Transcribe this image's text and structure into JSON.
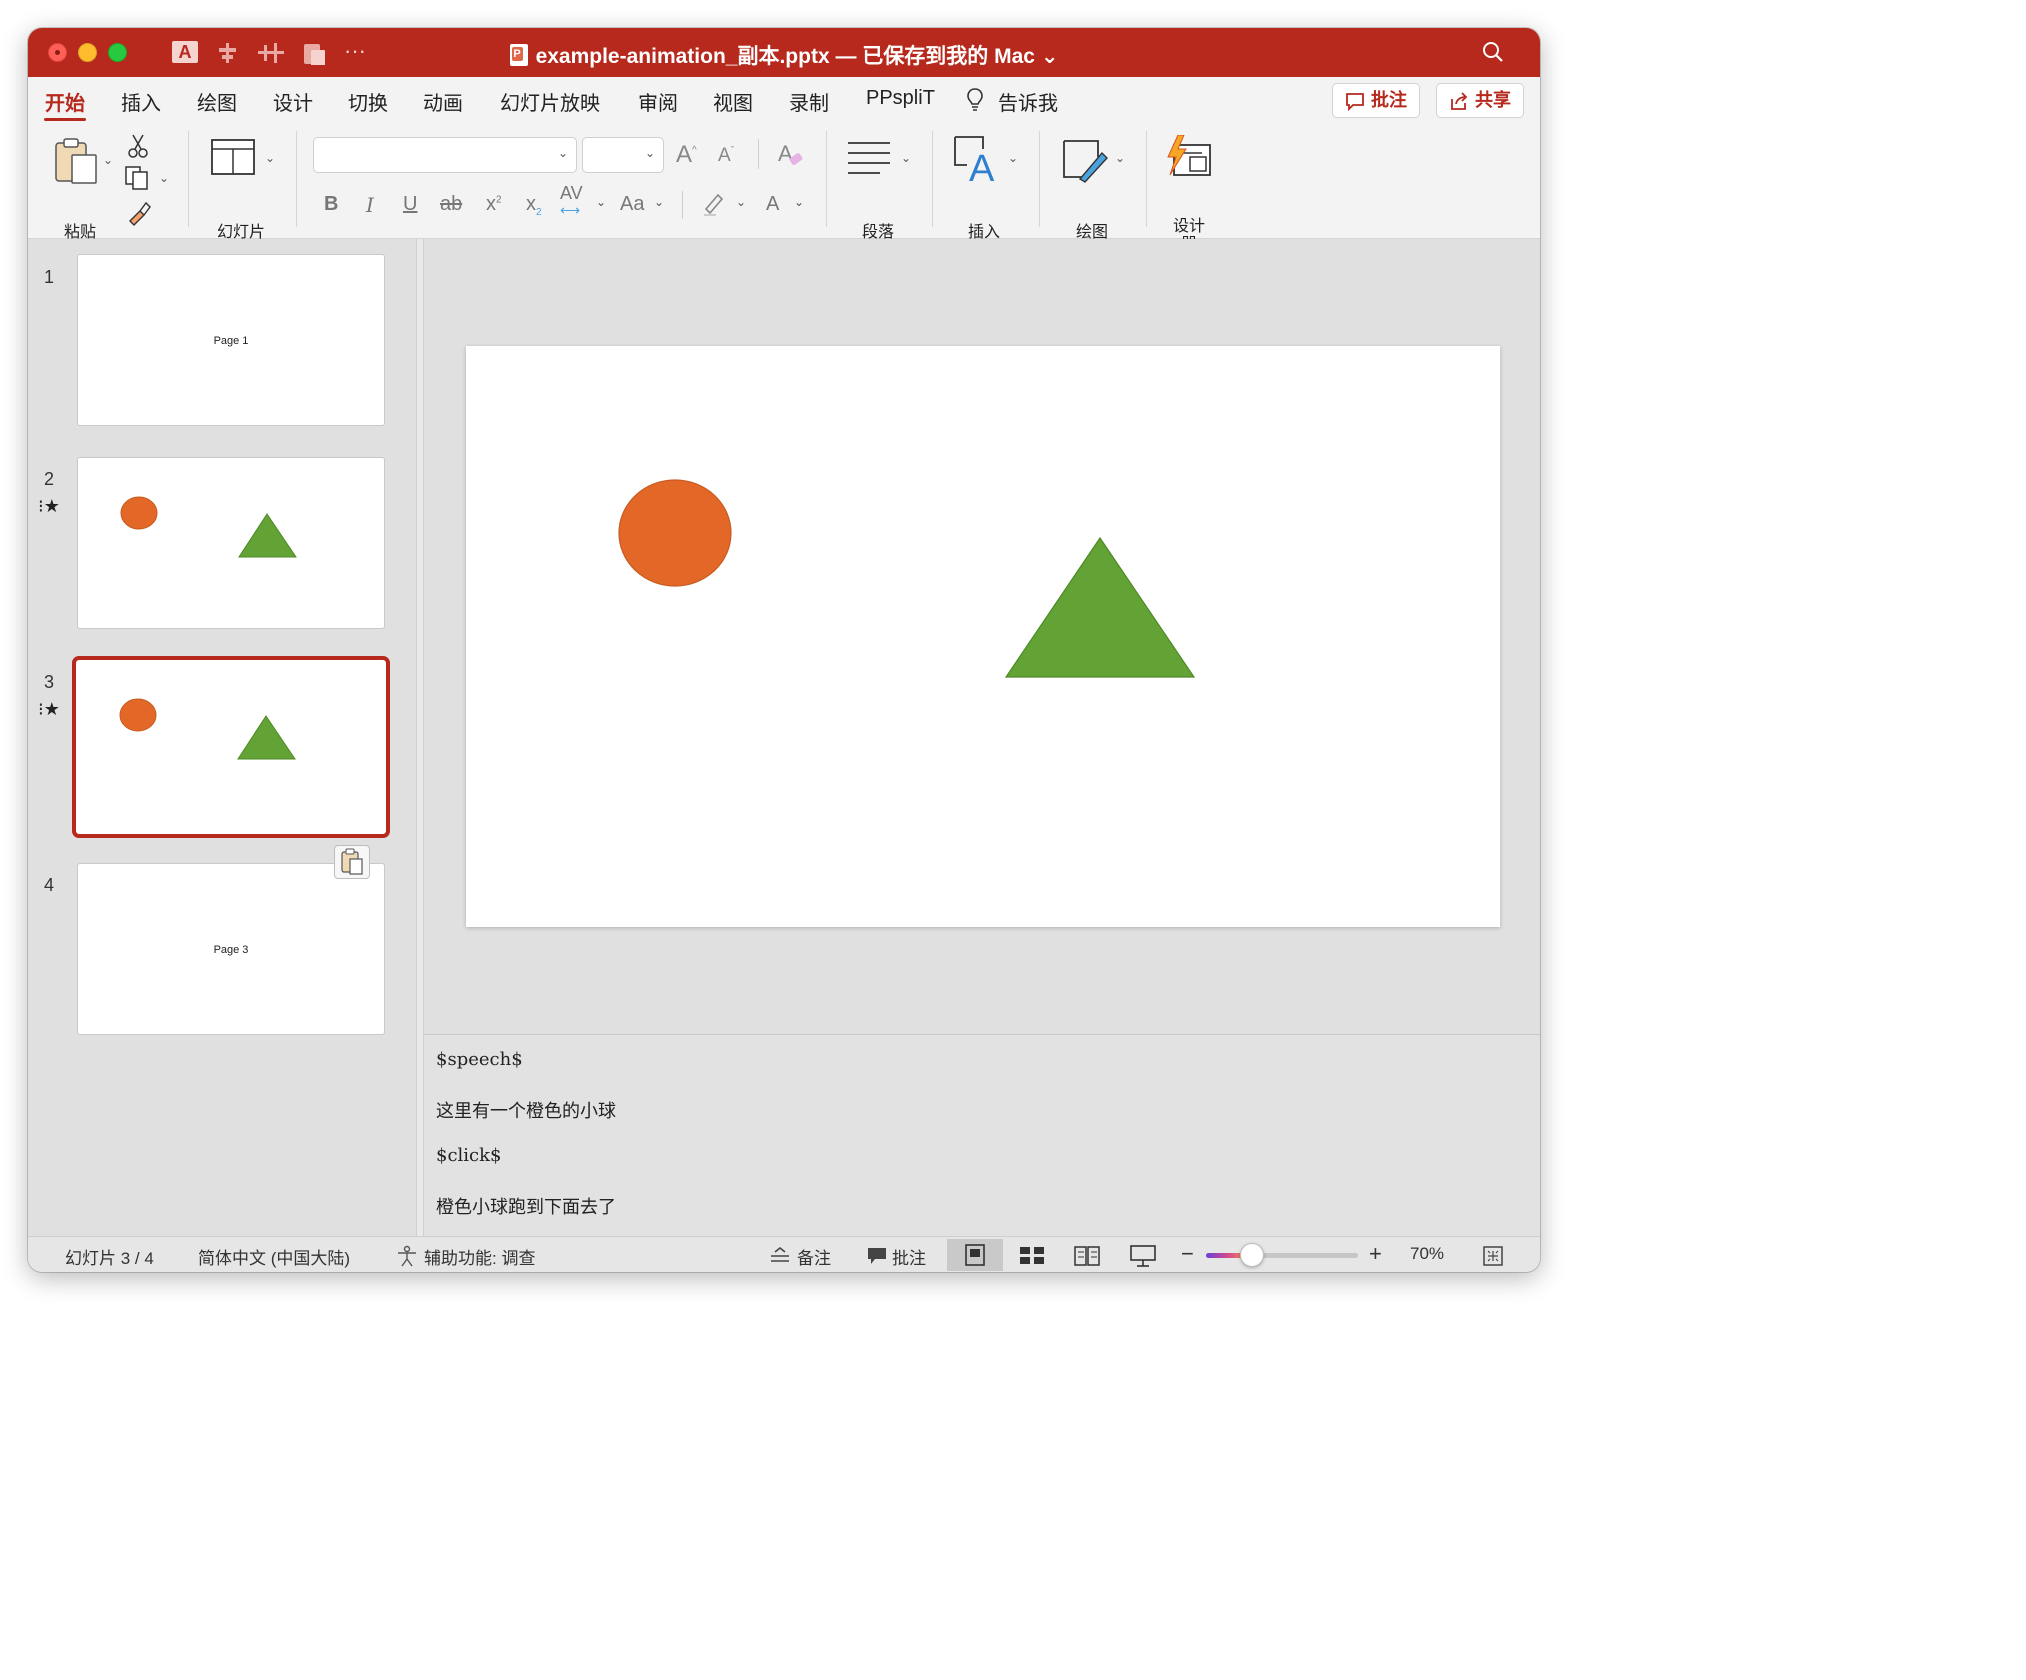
{
  "titlebar": {
    "title": "example-animation_副本.pptx — 已保存到我的 Mac ⌄",
    "qa_font_glyph": "A",
    "qa_more": "···"
  },
  "tabs": [
    {
      "label": "开始",
      "active": true
    },
    {
      "label": "插入"
    },
    {
      "label": "绘图"
    },
    {
      "label": "设计"
    },
    {
      "label": "切换"
    },
    {
      "label": "动画"
    },
    {
      "label": "幻灯片放映"
    },
    {
      "label": "审阅"
    },
    {
      "label": "视图"
    },
    {
      "label": "录制"
    },
    {
      "label": "PPspliT"
    },
    {
      "label": "告诉我"
    }
  ],
  "top_buttons": {
    "comments": "批注",
    "share": "共享"
  },
  "ribbon": {
    "paste": "粘贴",
    "slides": "幻灯片",
    "font_name": "",
    "font_size": "",
    "grow_font": "A",
    "shrink_font": "A",
    "bold": "B",
    "italic": "I",
    "underline": "U",
    "strike": "ab",
    "superscript": "x",
    "subscript": "x",
    "spacing": "AV",
    "change_case": "Aa",
    "font_color": "A",
    "paragraph": "段落",
    "insert": "插入",
    "draw": "绘图",
    "designer": "设计\n器"
  },
  "slides": [
    {
      "number": "1",
      "text": "Page 1",
      "animated": false
    },
    {
      "number": "2",
      "text": "",
      "animated": true
    },
    {
      "number": "3",
      "text": "",
      "animated": true,
      "selected": true
    },
    {
      "number": "4",
      "text": "Page 3",
      "animated": false
    }
  ],
  "animation_marker": "⁝★",
  "colors": {
    "accent": "#b6291c",
    "orange_ball": "#e36827",
    "green_triangle": "#63a235"
  },
  "notes": [
    "$speech$",
    "这里有一个橙色的小球",
    "$click$",
    "橙色小球跑到下面去了"
  ],
  "status": {
    "slide_pos": "幻灯片 3 / 4",
    "language": "简体中文 (中国大陆)",
    "accessibility": "辅助功能: 调查",
    "notes_btn": "备注",
    "comments_btn": "批注",
    "zoom_minus": "−",
    "zoom_plus": "+",
    "zoom_level": "70%",
    "zoom_fraction": 0.3
  }
}
